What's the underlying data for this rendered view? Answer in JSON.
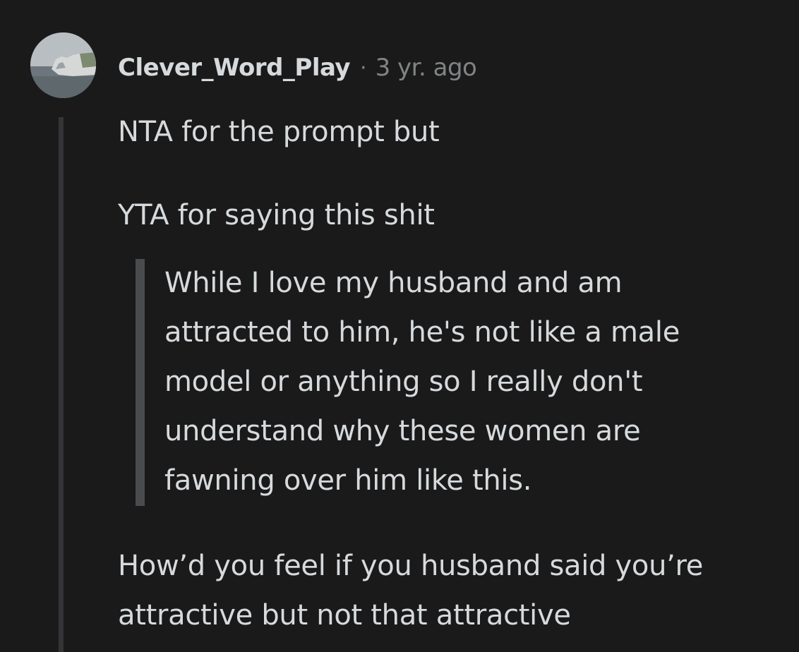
{
  "comment": {
    "author": "Clever_Word_Play",
    "separator": "·",
    "timestamp": "3 yr. ago",
    "avatar_icon": "avatar-cliff-photo",
    "paragraphs": [
      "NTA for the prompt but",
      "YTA for saying this shit"
    ],
    "quote_lines": [
      "While I love my husband and am",
      "attracted to him, he's not like a male",
      "model or anything so I really don't",
      "understand why these women are",
      "fawning over him like this."
    ],
    "closing_lines": [
      "How’d you feel if you husband said you’re",
      "attractive but not that attractive"
    ]
  },
  "colors": {
    "background": "#1a1a1b",
    "text": "#d7dadc",
    "meta_text": "#818384",
    "thread_line": "#343536",
    "quote_bar": "#4a4b4c"
  }
}
